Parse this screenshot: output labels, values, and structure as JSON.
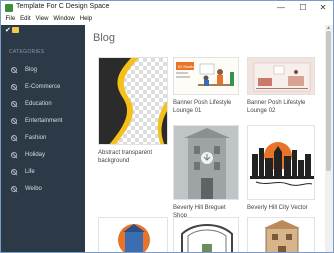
{
  "window": {
    "title": "Template For C Design Space",
    "minimize": "—",
    "maximize": "☐",
    "close": "✕"
  },
  "menu": [
    "File",
    "Edit",
    "View",
    "Window",
    "Help"
  ],
  "sidebar": {
    "heading": "CATEGORIES",
    "items": [
      "Blog",
      "E-Commerce",
      "Education",
      "Entertainment",
      "Fashion",
      "Holiday",
      "Life",
      "Weibo"
    ]
  },
  "main": {
    "title": "Blog",
    "cards": [
      {
        "label": "Abstract transparent background"
      },
      {
        "label": "Banner Posh Lifestyle Lounge 01",
        "banner_text": "ID Studio"
      },
      {
        "label": "Banner Posh Lifestyle Lounge 02"
      },
      {
        "label": "Beverly Hill Breguet Shop"
      },
      {
        "label": "Beverly Hill City Vector"
      }
    ]
  },
  "colors": {
    "sidebar": "#2c3a47",
    "accent_orange": "#e8742a",
    "accent_yellow": "#f5c01a"
  }
}
